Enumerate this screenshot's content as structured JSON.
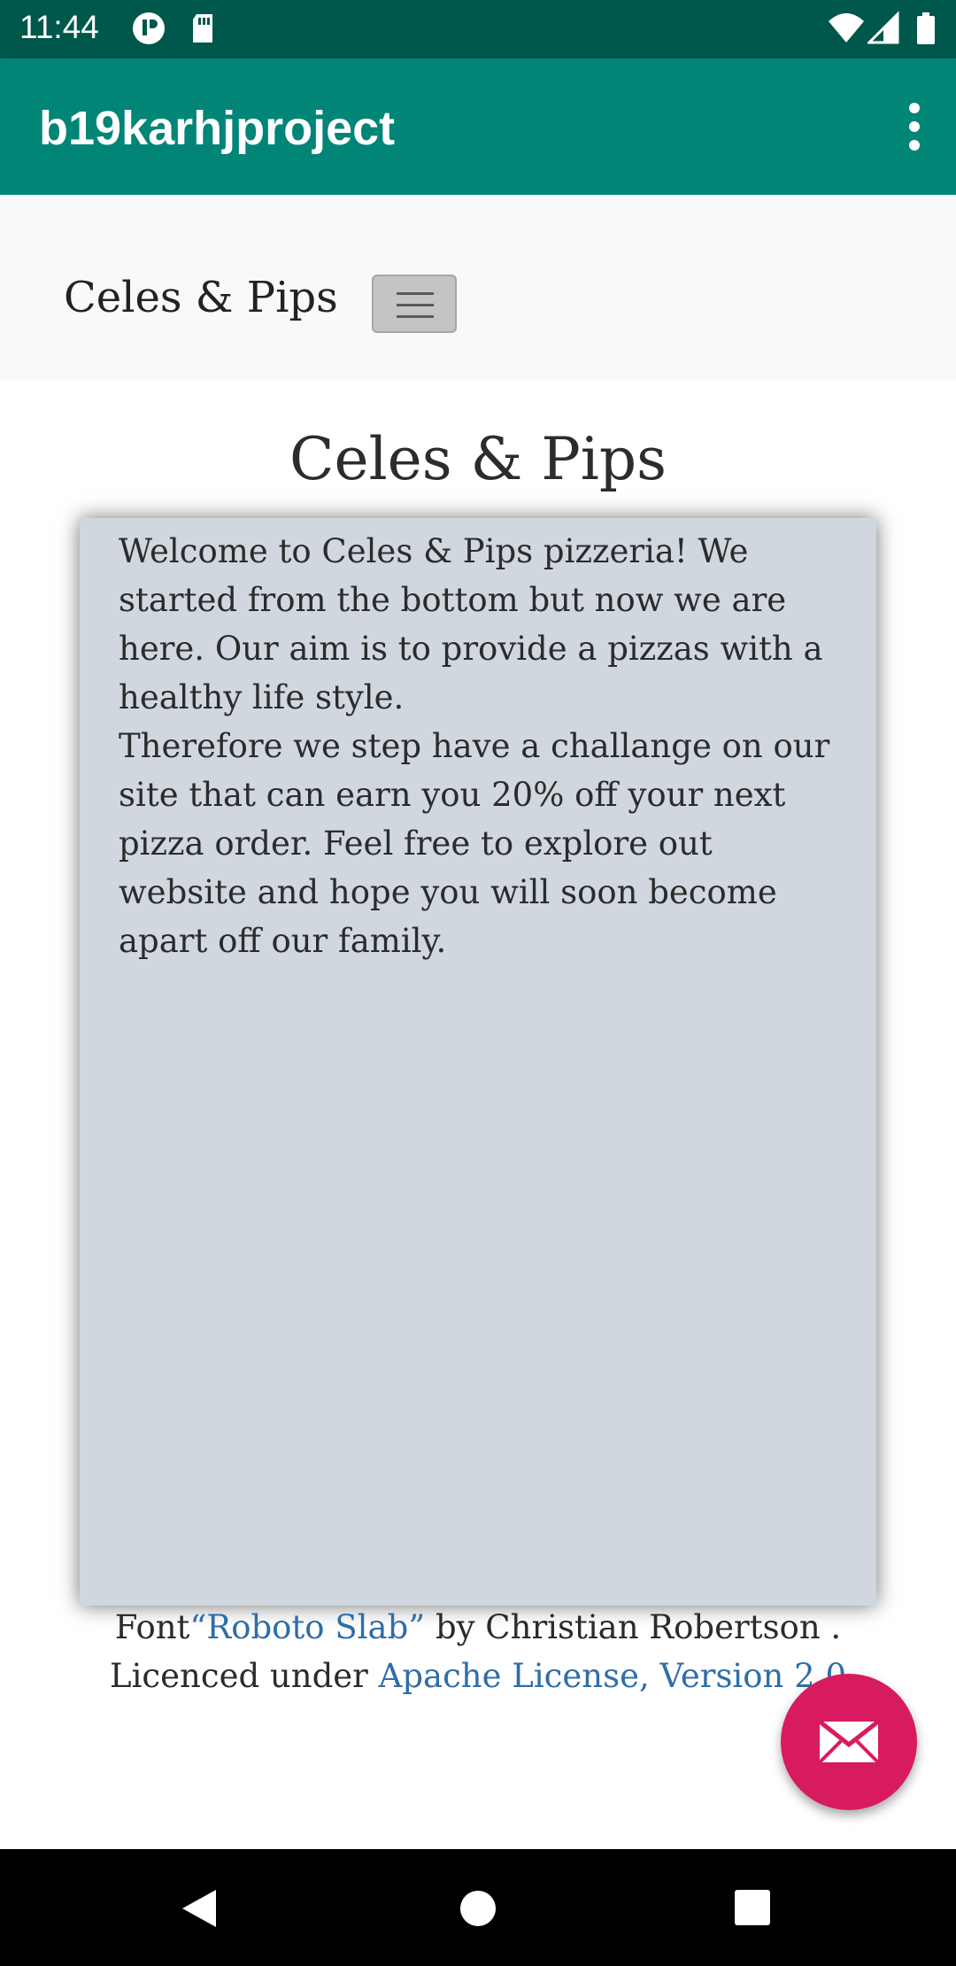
{
  "status_bar": {
    "time": "11:44",
    "icons": [
      "app-notification-icon",
      "sd-card-icon",
      "wifi-icon",
      "signal-icon",
      "battery-icon"
    ]
  },
  "app_bar": {
    "title": "b19karhjproject",
    "menu_icon": "more-vert-icon"
  },
  "site_nav": {
    "brand": "Celes & Pips",
    "toggler_icon": "hamburger-menu-icon"
  },
  "main": {
    "heading": "Celes & Pips",
    "paragraph_1": "Welcome to Celes & Pips pizzeria! We started from the bottom but now we are here. Our aim is to provide a pizzas with a healthy life style.",
    "paragraph_2": "Therefore we step have a challange on our site that can earn you 20% off your next pizza order. Feel free to explore out website and hope you will soon become apart off our family."
  },
  "footer": {
    "font_prefix": "Font",
    "font_link": "“Roboto Slab”",
    "font_suffix": " by Christian Robertson .",
    "licence_prefix": "Licenced under ",
    "licence_link": "Apache License, Version 2.0"
  },
  "fab": {
    "icon": "mail-icon"
  },
  "colors": {
    "status_bar": "#00574b",
    "app_bar": "#008577",
    "fab": "#d81b60",
    "card": "#d0d7de",
    "link": "#2f6ea8"
  },
  "system_nav": [
    "back-icon",
    "home-icon",
    "recents-icon"
  ]
}
